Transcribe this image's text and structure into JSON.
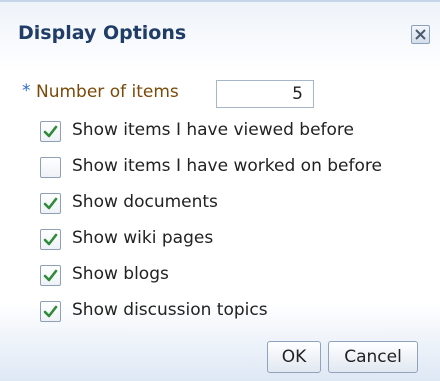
{
  "dialog": {
    "title": "Display Options",
    "close_icon": "close-icon"
  },
  "number_of_items": {
    "required_marker": "*",
    "label": "Number of items",
    "value": "5"
  },
  "options": [
    {
      "label": "Show items I have viewed before",
      "checked": true
    },
    {
      "label": "Show items I have worked on before",
      "checked": false
    },
    {
      "label": "Show documents",
      "checked": true
    },
    {
      "label": "Show wiki pages",
      "checked": true
    },
    {
      "label": "Show blogs",
      "checked": true
    },
    {
      "label": "Show discussion topics",
      "checked": true
    }
  ],
  "buttons": {
    "ok": "OK",
    "cancel": "Cancel"
  },
  "colors": {
    "title": "#1f3d66",
    "required": "#2a6bc9",
    "field_label": "#7a4a08",
    "check": "#2e8b3a"
  }
}
